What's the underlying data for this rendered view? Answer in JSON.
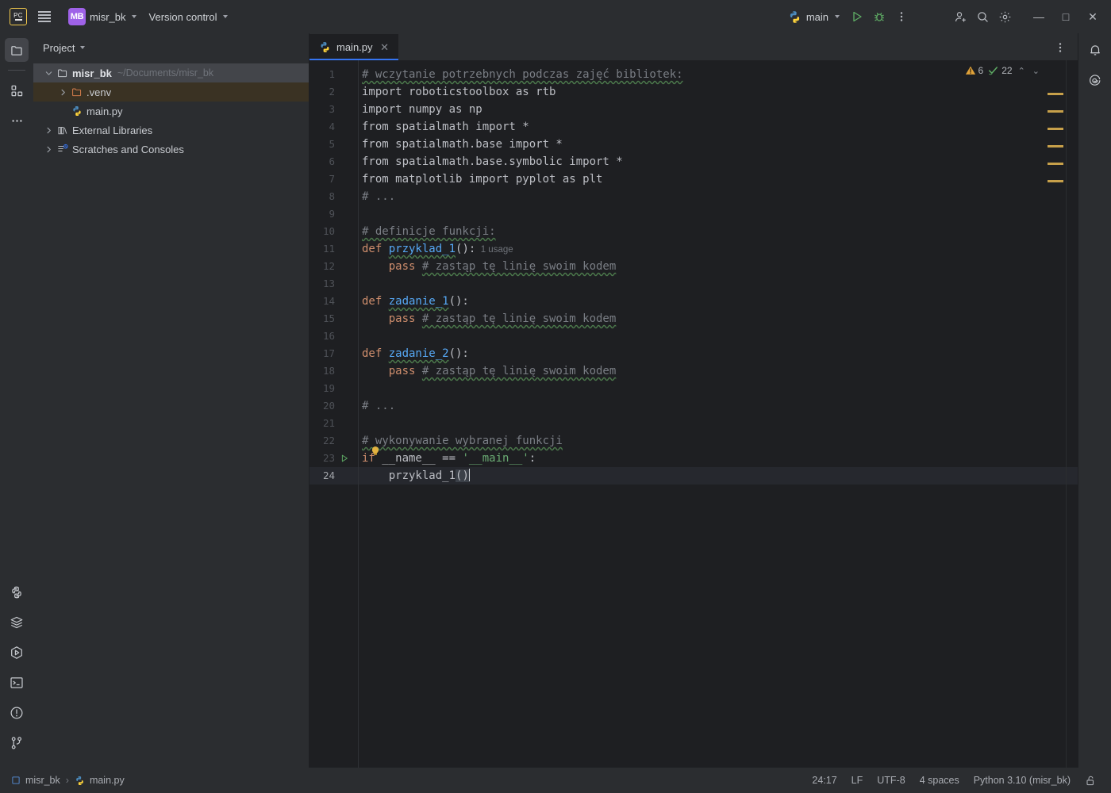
{
  "titlebar": {
    "logo_name": "pycharm-logo",
    "menu_icon": "hamburger-menu-icon",
    "project_badge": "MB",
    "project_name": "misr_bk",
    "version_control": "Version control",
    "run_config": "main",
    "run_icon": "run-icon",
    "debug_icon": "debug-icon",
    "more_icon": "more-actions-icon",
    "account_icon": "add-account-icon",
    "search_icon": "search-icon",
    "settings_icon": "settings-gear-icon",
    "minimize": "—",
    "maximize": "□",
    "close": "✕"
  },
  "left_rail": {
    "top": [
      {
        "name": "project-tool-icon",
        "active": true
      },
      {
        "name": "structure-tool-icon",
        "active": false
      },
      {
        "name": "more-tool-windows-icon",
        "active": false
      }
    ],
    "bottom": [
      {
        "name": "python-console-icon"
      },
      {
        "name": "python-packages-icon"
      },
      {
        "name": "run-tool-icon"
      },
      {
        "name": "terminal-icon"
      },
      {
        "name": "problems-icon"
      },
      {
        "name": "version-control-icon"
      }
    ]
  },
  "right_rail": {
    "items": [
      {
        "name": "notifications-bell-icon"
      },
      {
        "name": "ai-assistant-icon"
      }
    ]
  },
  "project_panel": {
    "title": "Project",
    "tree": [
      {
        "label": "misr_bk",
        "path": "~/Documents/misr_bk",
        "indent": 0,
        "arrow": "down",
        "icon": "folder-icon",
        "state": "selected"
      },
      {
        "label": ".venv",
        "path": "",
        "indent": 1,
        "arrow": "right",
        "icon": "folder-orange-icon",
        "state": "excluded"
      },
      {
        "label": "main.py",
        "path": "",
        "indent": 1,
        "arrow": "none",
        "icon": "python-file-icon",
        "state": "normal"
      },
      {
        "label": "External Libraries",
        "path": "",
        "indent": 0,
        "arrow": "right",
        "icon": "libraries-icon",
        "state": "normal"
      },
      {
        "label": "Scratches and Consoles",
        "path": "",
        "indent": 0,
        "arrow": "right",
        "icon": "scratches-icon",
        "state": "normal"
      }
    ]
  },
  "editor": {
    "tab": {
      "label": "main.py",
      "icon": "python-file-icon",
      "close": "✕"
    },
    "options_icon": "editor-options-icon",
    "inspections": {
      "warning_icon": "warning-triangle-icon",
      "warning_count": "6",
      "ok_icon": "inspection-ok-icon",
      "ok_count": "22",
      "prev_icon": "⌃",
      "next_icon": "⌄"
    },
    "cursor_line": 24,
    "inlay_hint": "1 usage",
    "lines": [
      {
        "n": 1,
        "tokens": [
          {
            "t": "# wczytanie potrzebnych podczas zajęć bibliotek:",
            "c": "cm sq"
          }
        ]
      },
      {
        "n": 2,
        "tokens": [
          {
            "t": "import roboticstoolbox as rtb",
            "c": "pl"
          }
        ]
      },
      {
        "n": 3,
        "tokens": [
          {
            "t": "import numpy as np",
            "c": "pl"
          }
        ]
      },
      {
        "n": 4,
        "tokens": [
          {
            "t": "from spatialmath import *",
            "c": "pl"
          }
        ]
      },
      {
        "n": 5,
        "tokens": [
          {
            "t": "from spatialmath.base import *",
            "c": "pl"
          }
        ]
      },
      {
        "n": 6,
        "tokens": [
          {
            "t": "from spatialmath.base.symbolic import *",
            "c": "pl"
          }
        ]
      },
      {
        "n": 7,
        "tokens": [
          {
            "t": "from matplotlib import pyplot as plt",
            "c": "pl"
          }
        ]
      },
      {
        "n": 8,
        "tokens": [
          {
            "t": "# ...",
            "c": "cm"
          }
        ]
      },
      {
        "n": 9,
        "tokens": []
      },
      {
        "n": 10,
        "tokens": [
          {
            "t": "# definicje funkcji:",
            "c": "cm sq"
          }
        ]
      },
      {
        "n": 11,
        "tokens": [
          {
            "t": "def ",
            "c": "k"
          },
          {
            "t": "przyklad_1",
            "c": "fn sq"
          },
          {
            "t": "():",
            "c": "pl"
          }
        ]
      },
      {
        "n": 12,
        "tokens": [
          {
            "t": "    pass ",
            "c": "k"
          },
          {
            "t": "# zastąp tę linię swoim kodem",
            "c": "cm sq"
          }
        ]
      },
      {
        "n": 13,
        "tokens": []
      },
      {
        "n": 14,
        "tokens": [
          {
            "t": "def ",
            "c": "k"
          },
          {
            "t": "zadanie_1",
            "c": "fn sq"
          },
          {
            "t": "():",
            "c": "pl"
          }
        ]
      },
      {
        "n": 15,
        "tokens": [
          {
            "t": "    pass ",
            "c": "k"
          },
          {
            "t": "# zastąp tę linię swoim kodem",
            "c": "cm sq"
          }
        ]
      },
      {
        "n": 16,
        "tokens": []
      },
      {
        "n": 17,
        "tokens": [
          {
            "t": "def ",
            "c": "k"
          },
          {
            "t": "zadanie_2",
            "c": "fn sq"
          },
          {
            "t": "():",
            "c": "pl"
          }
        ]
      },
      {
        "n": 18,
        "tokens": [
          {
            "t": "    pass ",
            "c": "k"
          },
          {
            "t": "# zastąp tę linię swoim kodem",
            "c": "cm sq"
          }
        ]
      },
      {
        "n": 19,
        "tokens": []
      },
      {
        "n": 20,
        "tokens": [
          {
            "t": "# ...",
            "c": "cm"
          }
        ]
      },
      {
        "n": 21,
        "tokens": []
      },
      {
        "n": 22,
        "tokens": [
          {
            "t": "# wykonywanie wybranej funkcji",
            "c": "cm sq"
          }
        ]
      },
      {
        "n": 23,
        "tokens": [
          {
            "t": "if",
            "c": "k"
          },
          {
            "t": " __name__ == ",
            "c": "pl"
          },
          {
            "t": "'__main__'",
            "c": "st"
          },
          {
            "t": ":",
            "c": "pl"
          }
        ]
      },
      {
        "n": 24,
        "tokens": [
          {
            "t": "    przyklad_1",
            "c": "pl"
          },
          {
            "t": "()",
            "c": "pl brk"
          }
        ]
      }
    ],
    "gutter_icons": [
      {
        "line": 23,
        "name": "run-line-icon"
      },
      {
        "line": 23,
        "name": "intention-bulb-icon"
      }
    ],
    "markers": [
      131,
      153,
      175,
      197,
      219,
      241
    ],
    "marker_color": "#c7a04a"
  },
  "status_bar": {
    "breadcrumb_project": "misr_bk",
    "breadcrumb_file": "main.py",
    "breadcrumb_sep": "›",
    "position": "24:17",
    "line_sep": "LF",
    "encoding": "UTF-8",
    "indent": "4 spaces",
    "interpreter": "Python 3.10 (misr_bk)",
    "lock_icon": "unlocked-icon"
  },
  "colors": {
    "accent": "#3574f0",
    "warning": "#c7a04a",
    "keyword": "#cf8e6d",
    "function": "#56a8f5",
    "string": "#6aab73",
    "comment": "#7a7e85",
    "badge": "#9f62e8"
  }
}
